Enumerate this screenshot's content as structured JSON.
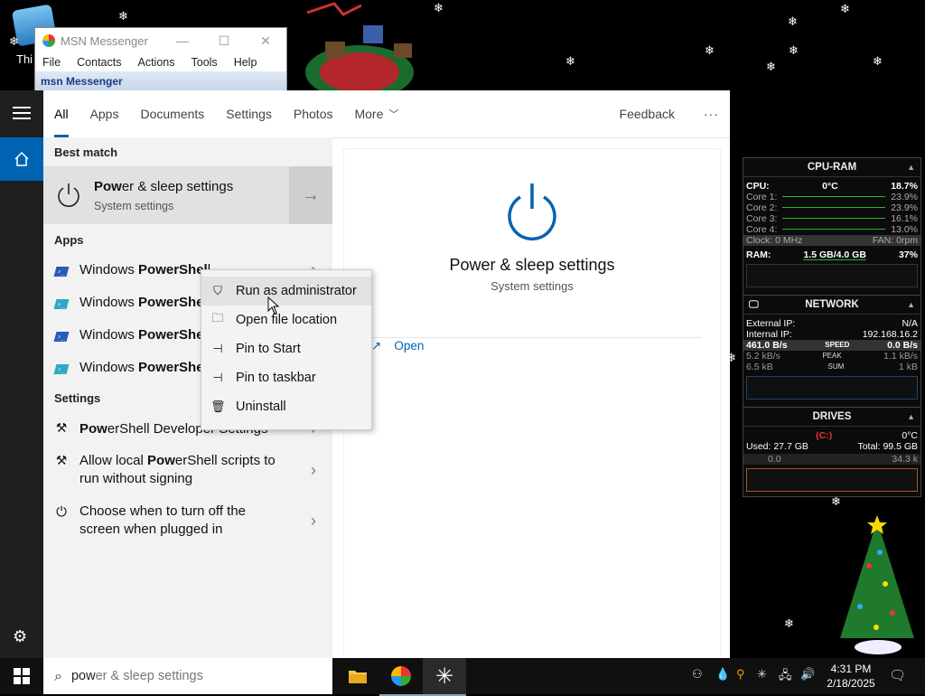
{
  "desktop": {
    "icon_label": "Thi"
  },
  "msn": {
    "title": "MSN Messenger",
    "menu": [
      "File",
      "Contacts",
      "Actions",
      "Tools",
      "Help"
    ],
    "bar_label": "msn Messenger"
  },
  "tabs": [
    "All",
    "Apps",
    "Documents",
    "Settings",
    "Photos",
    "More"
  ],
  "feedback": "Feedback",
  "more_options": "···",
  "best_match": {
    "header": "Best match",
    "title_bold": "Pow",
    "title_rest": "er & sleep settings",
    "subtitle": "System settings"
  },
  "apps": {
    "header": "Apps",
    "items": [
      {
        "pre": "Windows ",
        "bold": "PowerShel",
        "rest": "l"
      },
      {
        "pre": "Windows ",
        "bold": "PowerShe",
        "rest": ""
      },
      {
        "pre": "Windows ",
        "bold": "PowerShe",
        "rest": ""
      },
      {
        "pre": "Windows ",
        "bold": "PowerShe",
        "rest": ""
      }
    ]
  },
  "settings": {
    "header": "Settings",
    "items": [
      {
        "line1_bold": "Pow",
        "line1_rest": "erShell Developer Settings",
        "line2": ""
      },
      {
        "line1_pre": "Allow local ",
        "line1_bold": "Pow",
        "line1_rest": "erShell scripts to",
        "line2": "run without signing"
      },
      {
        "line1_pre": "Choose when to turn off the",
        "line1_bold": "",
        "line1_rest": "",
        "line2": "screen when plugged in"
      }
    ]
  },
  "preview": {
    "title": "Power & sleep settings",
    "subtitle": "System settings",
    "open": "Open"
  },
  "context_menu": [
    {
      "label": "Run as administrator"
    },
    {
      "label": "Open file location"
    },
    {
      "label": "Pin to Start"
    },
    {
      "label": "Pin to taskbar"
    },
    {
      "label": "Uninstall"
    }
  ],
  "search": {
    "typed": "pow",
    "suggest": "er & sleep settings"
  },
  "gadgets": {
    "cpu": {
      "title": "CPU-RAM",
      "cpu_label": "CPU:",
      "temp": "0°C",
      "cpu_pct": "18.7%",
      "cores": [
        {
          "label": "Core 1:",
          "pct": "23.9%"
        },
        {
          "label": "Core 2:",
          "pct": "23.9%"
        },
        {
          "label": "Core 3:",
          "pct": "16.1%"
        },
        {
          "label": "Core 4:",
          "pct": "13.0%"
        }
      ],
      "clock": "Clock: 0 MHz",
      "fan": "FAN: 0rpm",
      "ram_label": "RAM:",
      "ram_value": "1.5 GB/4.0 GB",
      "ram_pct": "37%"
    },
    "network": {
      "title": "NETWORK",
      "ext_label": "External IP:",
      "ext_val": "N/A",
      "int_label": "Internal IP:",
      "int_val": "192.168.16.2",
      "rows": [
        {
          "left": "461.0 B/s",
          "mid": "SPEED",
          "right": "0.0 B/s"
        },
        {
          "left": "5.2 kB/s",
          "mid": "PEAK",
          "right": "1.1 kB/s"
        },
        {
          "left": "6.5 kB",
          "mid": "SUM",
          "right": "1 kB"
        }
      ]
    },
    "drives": {
      "title": "DRIVES",
      "drive": "(C:)",
      "temp": "0°C",
      "used": "Used: 27.7 GB",
      "total": "Total: 99.5 GB",
      "read": "0.0",
      "write": "34.3 k"
    }
  },
  "clock": {
    "time": "4:31 PM",
    "date": "2/18/2025"
  },
  "colors": {
    "accent": "#0063b1",
    "ps_blue": "#2a5bb8",
    "taskbar": "#101010"
  }
}
